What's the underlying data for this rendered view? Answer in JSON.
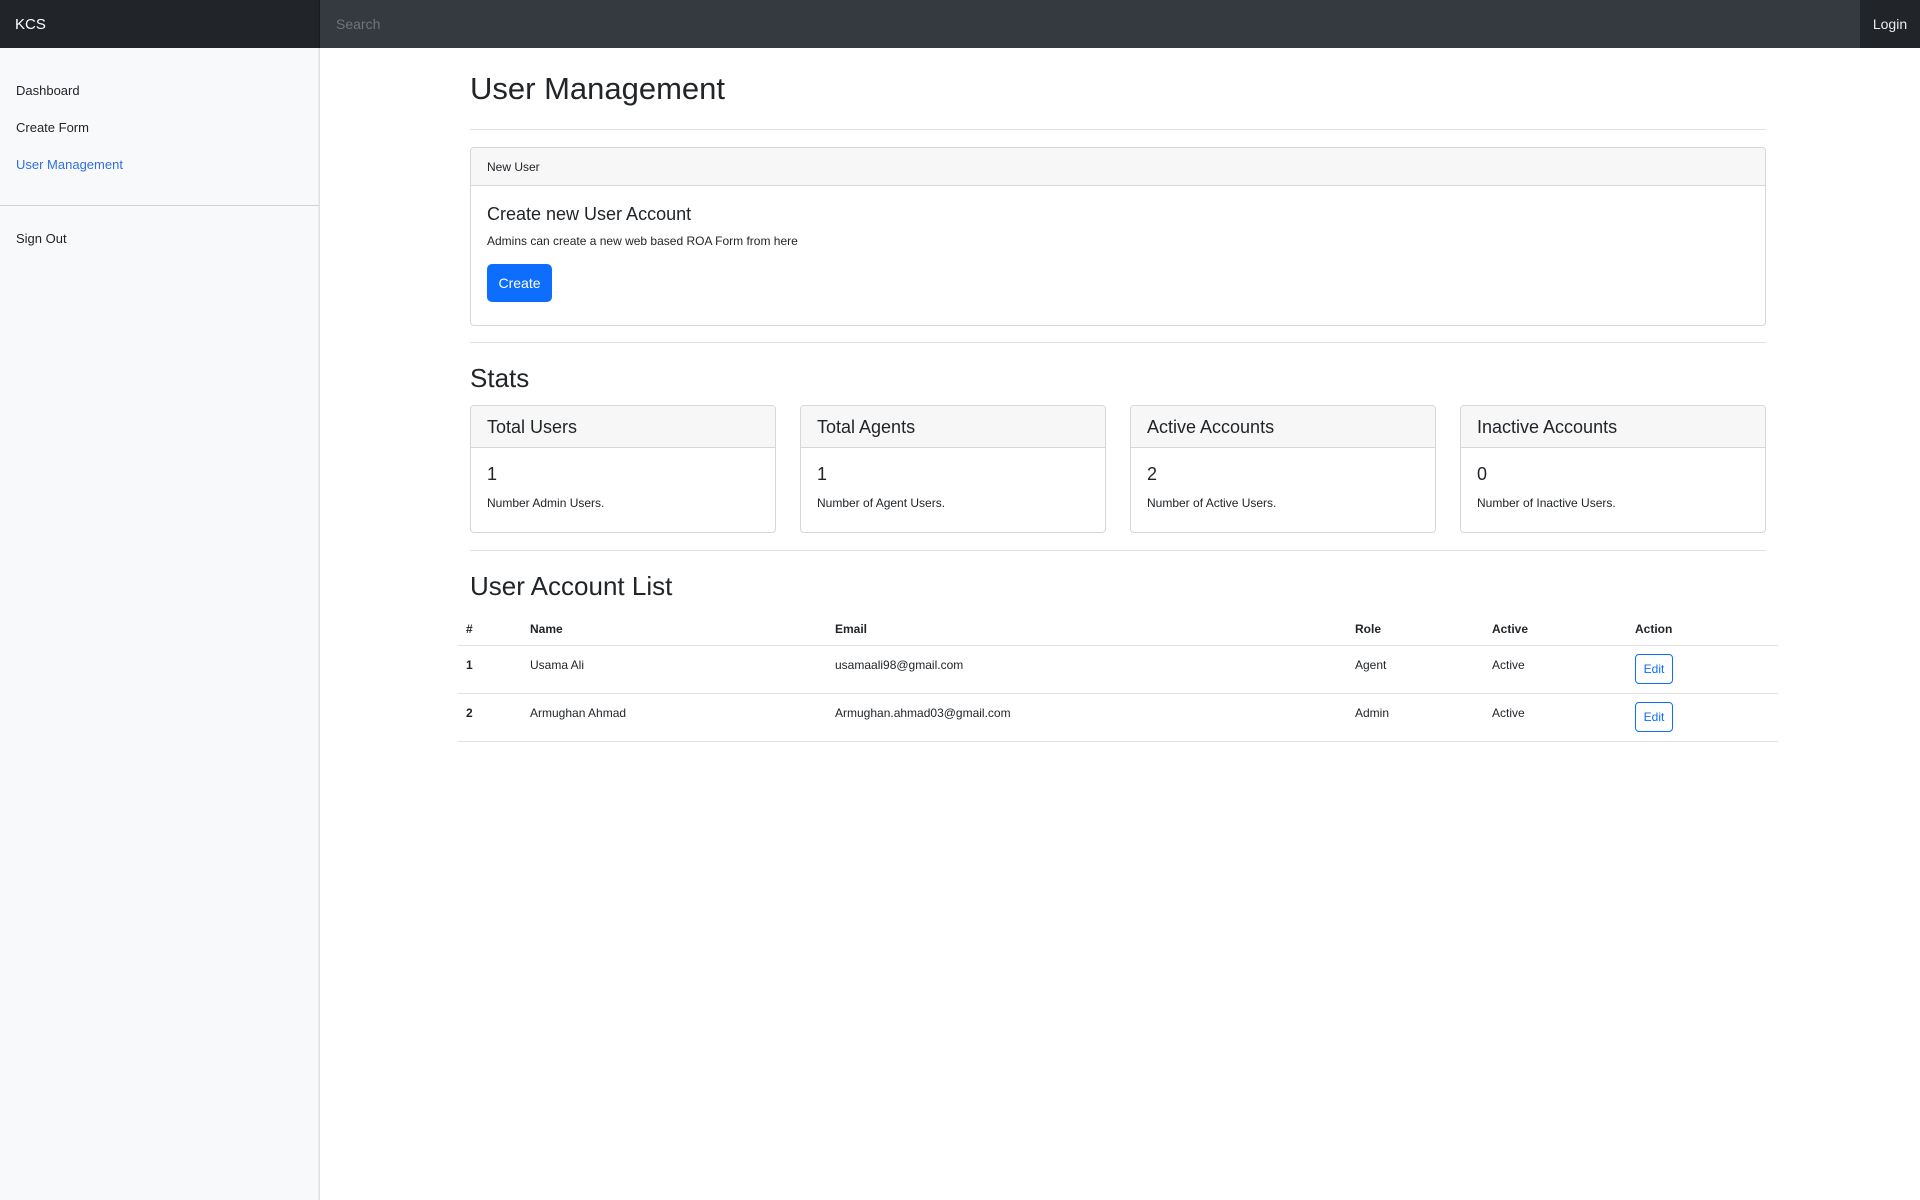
{
  "navbar": {
    "brand": "KCS",
    "search_placeholder": "Search",
    "login_label": "Login"
  },
  "sidebar": {
    "items": [
      {
        "label": "Dashboard"
      },
      {
        "label": "Create Form"
      },
      {
        "label": "User Management",
        "active": true
      }
    ],
    "signout_label": "Sign Out"
  },
  "main": {
    "title": "User Management",
    "new_user_card": {
      "header": "New User",
      "title": "Create new User Account",
      "text": "Admins can create a new web based ROA Form from here",
      "button_label": "Create"
    },
    "stats_title": "Stats",
    "stats": [
      {
        "header": "Total Users",
        "value": "1",
        "desc": "Number Admin Users."
      },
      {
        "header": "Total Agents",
        "value": "1",
        "desc": "Number of Agent Users."
      },
      {
        "header": "Active Accounts",
        "value": "2",
        "desc": "Number of Active Users."
      },
      {
        "header": "Inactive Accounts",
        "value": "0",
        "desc": "Number of Inactive Users."
      }
    ],
    "list_title": "User Account List",
    "table": {
      "columns": [
        "#",
        "Name",
        "Email",
        "Role",
        "Active",
        "Action"
      ],
      "rows": [
        {
          "num": "1",
          "name": "Usama Ali",
          "email": "usamaali98@gmail.com",
          "role": "Agent",
          "active": "Active",
          "action": "Edit"
        },
        {
          "num": "2",
          "name": "Armughan Ahmad",
          "email": "Armughan.ahmad03@gmail.com",
          "role": "Admin",
          "active": "Active",
          "action": "Edit"
        }
      ]
    }
  },
  "colors": {
    "navbar_bg": "#343a40",
    "brand_bg": "#212529",
    "primary": "#0d6efd",
    "active_link": "#2f6fdf",
    "sidebar_bg": "#f8f9fa"
  }
}
